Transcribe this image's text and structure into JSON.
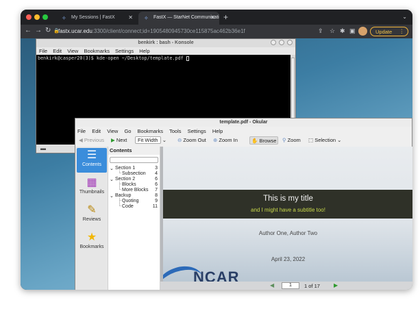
{
  "browser": {
    "tabs": [
      {
        "label": "My Sessions | FastX",
        "active": false
      },
      {
        "label": "FastX — StarNet Communicati",
        "active": true
      }
    ],
    "url_host": "fastx.ucar.edu",
    "url_rest": ":3300/client/connect;id=1905480945730ce115875ac462b36e1f",
    "update_label": "Update"
  },
  "konsole": {
    "title": "benkirk : bash - Konsole",
    "menu": [
      "File",
      "Edit",
      "View",
      "Bookmarks",
      "Settings",
      "Help"
    ],
    "prompt": "benkirk@casper20(3)$ kde-open ~/Desktop/template.pdf"
  },
  "okular": {
    "title": "template.pdf - Okular",
    "menu": [
      "File",
      "Edit",
      "View",
      "Go",
      "Bookmarks",
      "Tools",
      "Settings",
      "Help"
    ],
    "toolbar": {
      "previous": "Previous",
      "next": "Next",
      "fit_width": "Fit Width",
      "zoom_out": "Zoom Out",
      "zoom_in": "Zoom In",
      "browse": "Browse",
      "zoom": "Zoom",
      "selection": "Selection"
    },
    "sidebar": [
      "Contents",
      "Thumbnails",
      "Reviews",
      "Bookmarks"
    ],
    "contents_header": "Contents",
    "toc": [
      {
        "label": "Section 1",
        "page": "3"
      },
      {
        "label": "Subsection",
        "page": "4"
      },
      {
        "label": "Section 2",
        "page": "6"
      },
      {
        "label": "Blocks",
        "page": "6"
      },
      {
        "label": "More Blocks",
        "page": "7"
      },
      {
        "label": "Backup",
        "page": "8"
      },
      {
        "label": "Quoting",
        "page": "9"
      },
      {
        "label": "Code",
        "page": "11"
      }
    ],
    "slide": {
      "title": "This is my title",
      "subtitle": "and I might have a subtitle too!",
      "authors": "Author One, Author Two",
      "date": "April 23, 2022",
      "logo_text": "NCAR"
    },
    "pagebar": {
      "current": "1",
      "of_text": "1   of   17"
    }
  }
}
